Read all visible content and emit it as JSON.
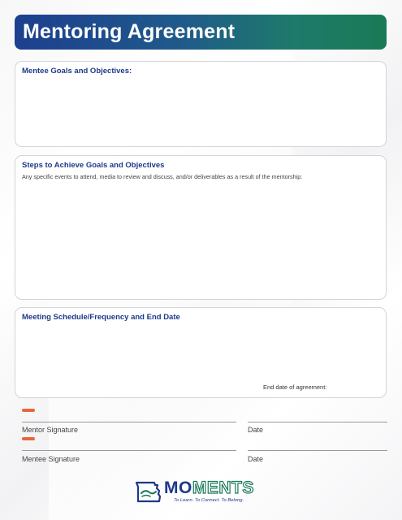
{
  "header": {
    "title": "Mentoring Agreement"
  },
  "sections": {
    "goals": {
      "title": "Mentee Goals and Objectives:"
    },
    "steps": {
      "title": "Steps to Achieve Goals and Objectives",
      "subtitle": "Any specific events to attend, media to review and discuss, and/or deliverables as a result of the mentorship:"
    },
    "schedule": {
      "title": "Meeting Schedule/Frequency and End Date",
      "end_date_label": "End date of agreement:"
    }
  },
  "signatures": {
    "mentor_label": "Mentor Signature",
    "mentee_label": "Mentee Signature",
    "date_label": "Date"
  },
  "logo": {
    "mo": "MO",
    "ments": "MENTS",
    "tagline": "To Learn. To Connect. To Belong."
  },
  "colors": {
    "brand_blue": "#1d3a8a",
    "brand_green": "#1a7a5a",
    "tag_orange": "#e8663a"
  }
}
